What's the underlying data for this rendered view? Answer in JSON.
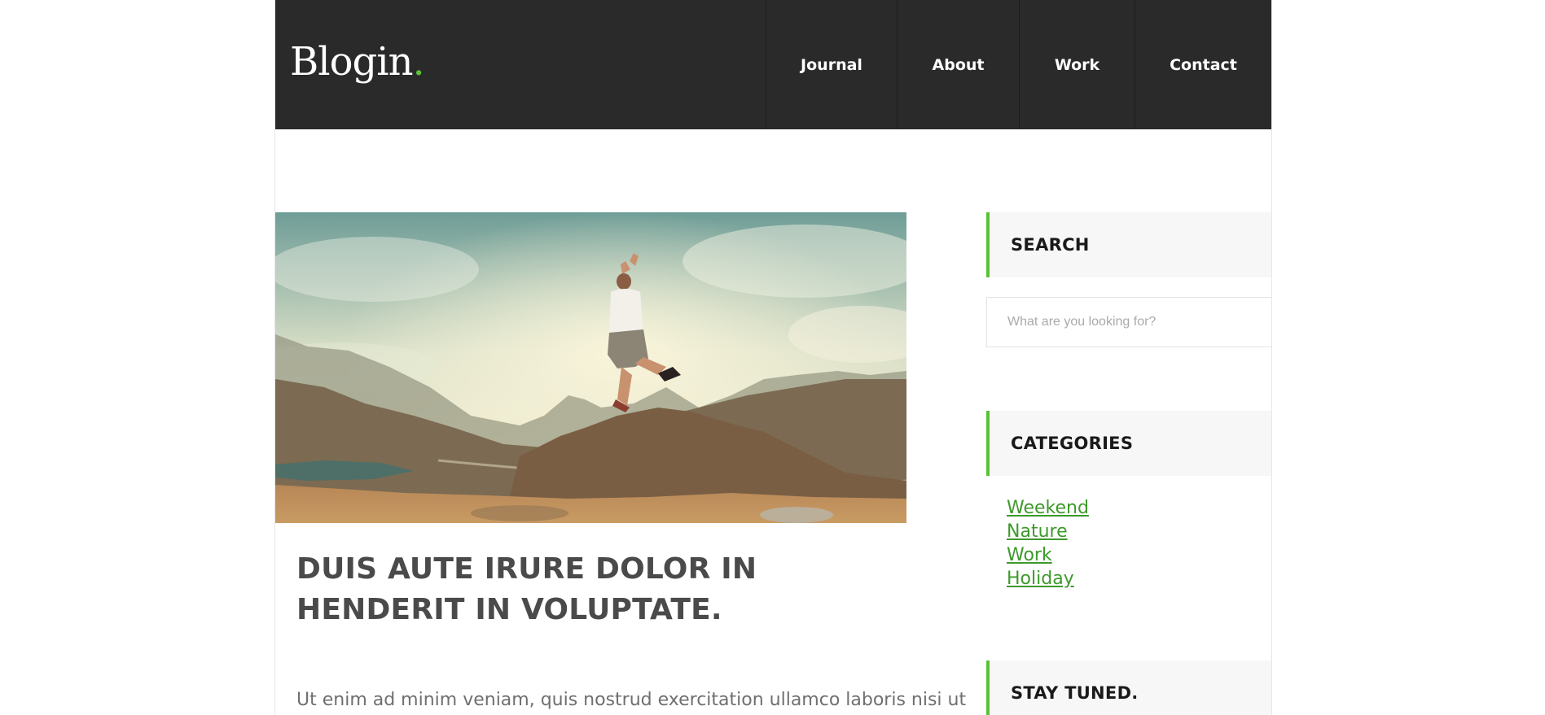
{
  "header": {
    "logo_text": "Blogin",
    "logo_dot": ".",
    "nav": [
      {
        "label": "Journal"
      },
      {
        "label": "About"
      },
      {
        "label": "Work"
      },
      {
        "label": "Contact"
      }
    ]
  },
  "post": {
    "image_alt": "person jumping on mountain",
    "title": "DUIS AUTE IRURE DOLOR IN HENDERIT IN VOLUPTATE.",
    "excerpt": "Ut enim ad minim veniam, quis nostrud exercitation ullamco laboris nisi ut"
  },
  "sidebar": {
    "search": {
      "title": "SEARCH",
      "placeholder": "What are you looking for?"
    },
    "categories": {
      "title": "CATEGORIES",
      "items": [
        {
          "label": "Weekend"
        },
        {
          "label": "Nature"
        },
        {
          "label": "Work"
        },
        {
          "label": "Holiday"
        }
      ]
    },
    "stay_tuned": {
      "title": "STAY TUNED."
    }
  },
  "colors": {
    "header_bg": "#2a2a2a",
    "accent": "#5bc236",
    "link": "#3d9a2b",
    "title_text": "#4a4a4a"
  }
}
